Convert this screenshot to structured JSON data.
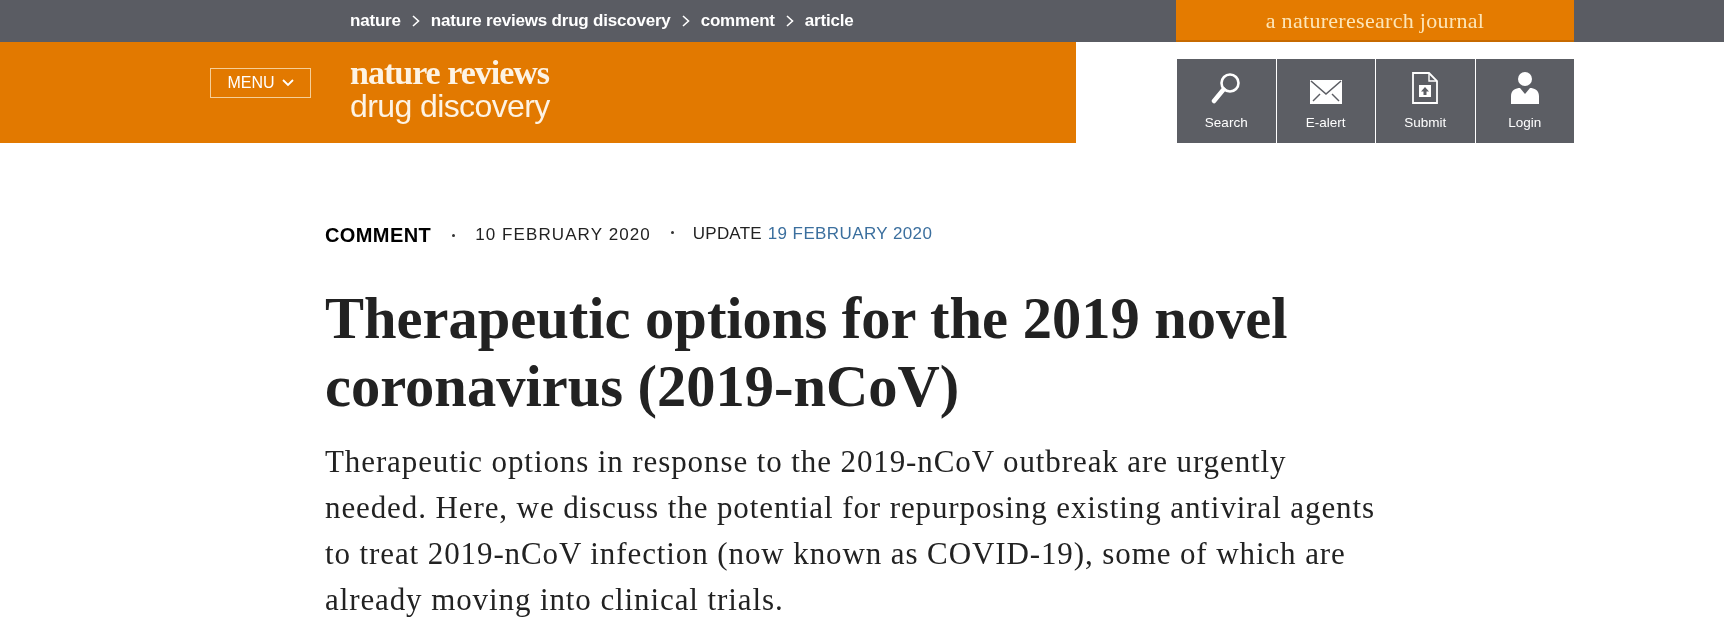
{
  "breadcrumb": [
    {
      "label": "nature"
    },
    {
      "label": "nature reviews drug discovery"
    },
    {
      "label": "comment"
    },
    {
      "label": "article"
    }
  ],
  "journal_banner": {
    "text": "a natureresearch journal"
  },
  "menu_button": {
    "label": "MENU"
  },
  "logo": {
    "line_1": "nature reviews",
    "line_2": "drug discovery"
  },
  "toolbar": [
    {
      "kind": "search",
      "label": "Search"
    },
    {
      "kind": "email",
      "label": "E-alert"
    },
    {
      "kind": "submit",
      "label": "Submit"
    },
    {
      "kind": "login",
      "label": "Login"
    }
  ],
  "article": {
    "type": "COMMENT",
    "published": "10 FEBRUARY 2020",
    "update_label": "UPDATE",
    "update_date": "19 FEBRUARY 2020",
    "title": "Therapeutic options for the 2019 novel coronavirus (2019-nCoV)",
    "standfirst": "Therapeutic options in response to the 2019-nCoV outbreak are urgently needed. Here, we discuss the potential for repurposing existing antiviral agents to treat 2019-nCoV infection (now known as COVID-19), some of which are already moving into clinical trials."
  }
}
